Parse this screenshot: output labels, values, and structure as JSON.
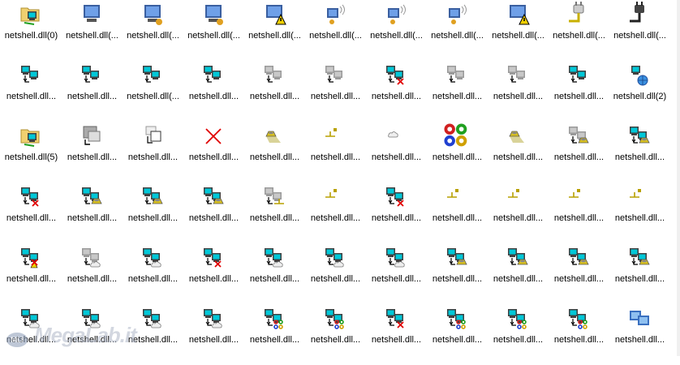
{
  "grid": {
    "rows": [
      [
        "netshell.dll(0)",
        "netshell.dll(...",
        "netshell.dll(...",
        "netshell.dll(...",
        "netshell.dll(...",
        "netshell.dll(...",
        "netshell.dll(...",
        "netshell.dll(...",
        "netshell.dll(...",
        "netshell.dll(...",
        "netshell.dll(..."
      ],
      [
        "netshell.dll...",
        "netshell.dll...",
        "netshell.dll(...",
        "netshell.dll...",
        "netshell.dll...",
        "netshell.dll...",
        "netshell.dll...",
        "netshell.dll...",
        "netshell.dll...",
        "netshell.dll...",
        "netshell.dll(2)"
      ],
      [
        "netshell.dll(5)",
        "netshell.dll...",
        "netshell.dll...",
        "netshell.dll...",
        "netshell.dll...",
        "netshell.dll...",
        "netshell.dll...",
        "netshell.dll...",
        "netshell.dll...",
        "netshell.dll...",
        "netshell.dll..."
      ],
      [
        "netshell.dll...",
        "netshell.dll...",
        "netshell.dll...",
        "netshell.dll...",
        "netshell.dll...",
        "netshell.dll...",
        "netshell.dll...",
        "netshell.dll...",
        "netshell.dll...",
        "netshell.dll...",
        "netshell.dll..."
      ],
      [
        "netshell.dll...",
        "netshell.dll...",
        "netshell.dll...",
        "netshell.dll...",
        "netshell.dll...",
        "netshell.dll...",
        "netshell.dll...",
        "netshell.dll...",
        "netshell.dll...",
        "netshell.dll...",
        "netshell.dll..."
      ],
      [
        "netshell.dll...",
        "netshell.dll...",
        "netshell.dll...",
        "netshell.dll...",
        "netshell.dll...",
        "netshell.dll...",
        "netshell.dll...",
        "netshell.dll...",
        "netshell.dll...",
        "netshell.dll...",
        "netshell.dll..."
      ]
    ],
    "icons": [
      [
        "folder-network",
        "computer-blue",
        "computer-user",
        "computer-user",
        "computer-warning",
        "computer-wireless",
        "computer-wireless",
        "computer-wireless",
        "computer-warning",
        "plug-light",
        "plug-dark"
      ],
      [
        "network-connection",
        "network-connection",
        "network-connection",
        "network-connection",
        "network-connection-gray",
        "network-connection-gray",
        "network-connection-error",
        "network-connection-gray",
        "network-connection-gray",
        "network-connection",
        "network-globe"
      ],
      [
        "folder-network",
        "computer-gray-arrow",
        "computer-arrow",
        "red-x",
        "modem",
        "network-tee",
        "cloud",
        "cmd-symbol",
        "modem",
        "network-modem-gray",
        "network-modem"
      ],
      [
        "network-error",
        "network-modem",
        "network-modem",
        "network-modem",
        "network-tee-gray",
        "network-tee",
        "network-error",
        "network-tee",
        "network-tee",
        "network-tee",
        "network-tee"
      ],
      [
        "network-warning-error",
        "network-cloud-gray",
        "network-cloud",
        "network-error",
        "network-cloud",
        "network-cloud",
        "network-cloud",
        "network-modem",
        "network-modem",
        "network-modem",
        "network-modem"
      ],
      [
        "network-cloud",
        "network-cloud",
        "network-cloud",
        "network-cloud",
        "network-cmd",
        "network-cmd",
        "network-error",
        "network-cmd",
        "network-cmd",
        "network-cmd",
        "computers-network"
      ]
    ]
  },
  "watermark": {
    "text": "MegaLab.it",
    "badge": "MLI"
  },
  "colors": {
    "screen": "#00c8d8",
    "monitor": "#5a5a5a",
    "x": "#e00000",
    "modem": "#d8c020",
    "blue": "#2f6fd8"
  }
}
